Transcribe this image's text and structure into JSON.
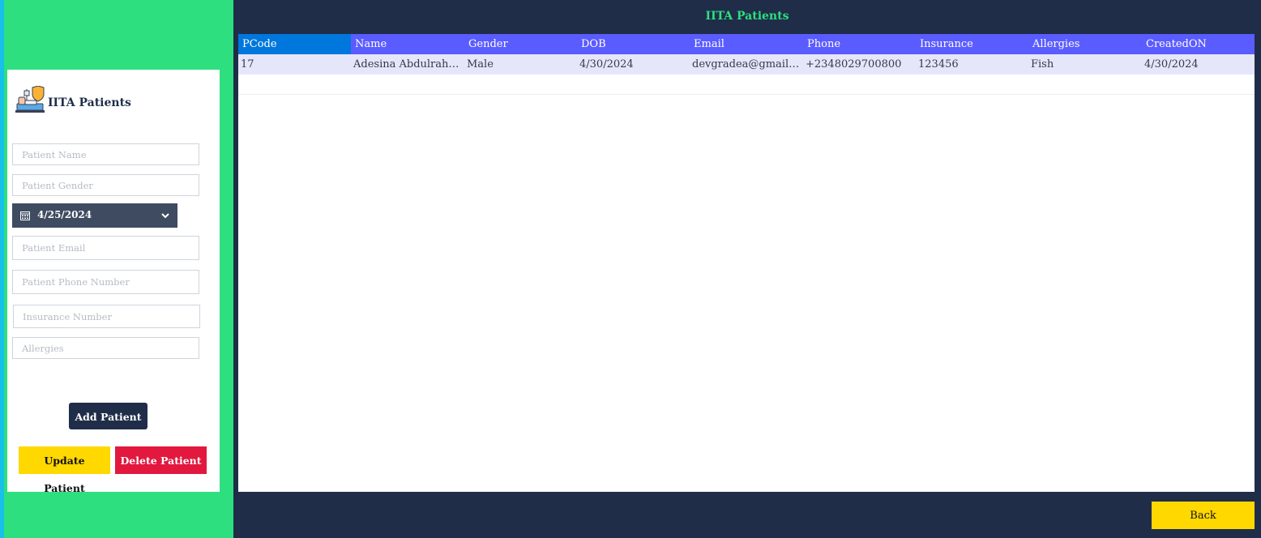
{
  "sidebar": {
    "brand": "IITA Patients",
    "form": {
      "name_placeholder": "Patient Name",
      "gender_placeholder": "Patient Gender",
      "dob_value": "4/25/2024",
      "email_placeholder": "Patient Email",
      "phone_placeholder": "Patient Phone Number",
      "insurance_placeholder": "Insurance Number",
      "allergies_placeholder": "Allergies"
    },
    "buttons": {
      "add": "Add Patient",
      "update": "Update Patient",
      "delete": "Delete Patient"
    }
  },
  "main": {
    "title": "IITA Patients",
    "table": {
      "columns": [
        "PCode",
        "Name",
        "Gender",
        "DOB",
        "Email",
        "Phone",
        "Insurance",
        "Allergies",
        "CreatedON"
      ],
      "rows": [
        [
          "17",
          "Adesina Abdulrahm...",
          "Male",
          "4/30/2024",
          "devgradea@gmail.c...",
          "+2348029700800",
          "123456",
          "Fish",
          "4/30/2024"
        ]
      ]
    },
    "back_label": "Back"
  },
  "colors": {
    "sidebar": "#2ddf7f",
    "background": "#1f2d48",
    "header": "#5b5cff",
    "active_header": "#0077dd",
    "accent_yellow": "#ffd800",
    "danger": "#e2183f"
  },
  "icons": {
    "logo": "patient-bed-shield-icon",
    "date": "calendar-icon",
    "dropdown": "chevron-down-icon"
  }
}
